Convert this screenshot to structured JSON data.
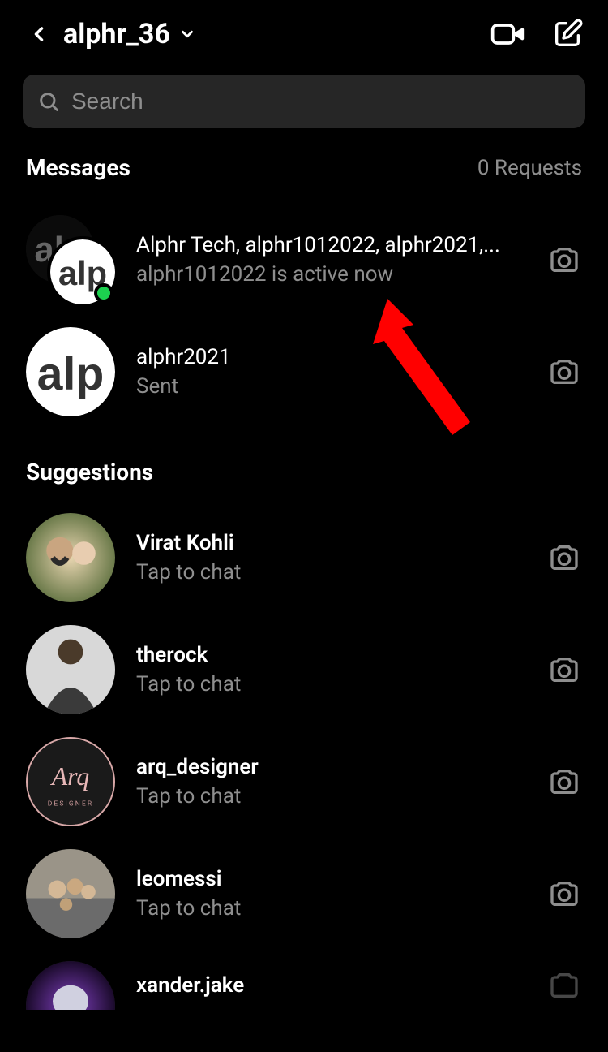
{
  "header": {
    "username": "alphr_36"
  },
  "search": {
    "placeholder": "Search"
  },
  "messages_section": {
    "title": "Messages",
    "requests": "0 Requests"
  },
  "messages": [
    {
      "title": "Alphr Tech, alphr1012022, alphr2021,...",
      "subtitle": "alphr1012022 is active now",
      "active": true,
      "avatar_type": "alp_group"
    },
    {
      "title": "alphr2021",
      "subtitle": "Sent",
      "active": false,
      "avatar_type": "alp"
    }
  ],
  "suggestions_section": {
    "title": "Suggestions"
  },
  "suggestions": [
    {
      "title": "Virat Kohli",
      "subtitle": "Tap to chat",
      "bold": true,
      "avatar_type": "photo1"
    },
    {
      "title": "therock",
      "subtitle": "Tap to chat",
      "bold": true,
      "avatar_type": "photo2"
    },
    {
      "title": "arq_designer",
      "subtitle": "Tap to chat",
      "bold": true,
      "avatar_type": "arq"
    },
    {
      "title": "leomessi",
      "subtitle": "Tap to chat",
      "bold": true,
      "avatar_type": "photo3"
    },
    {
      "title": "xander.jake",
      "subtitle": "",
      "bold": true,
      "avatar_type": "photo4",
      "partial": true
    }
  ]
}
